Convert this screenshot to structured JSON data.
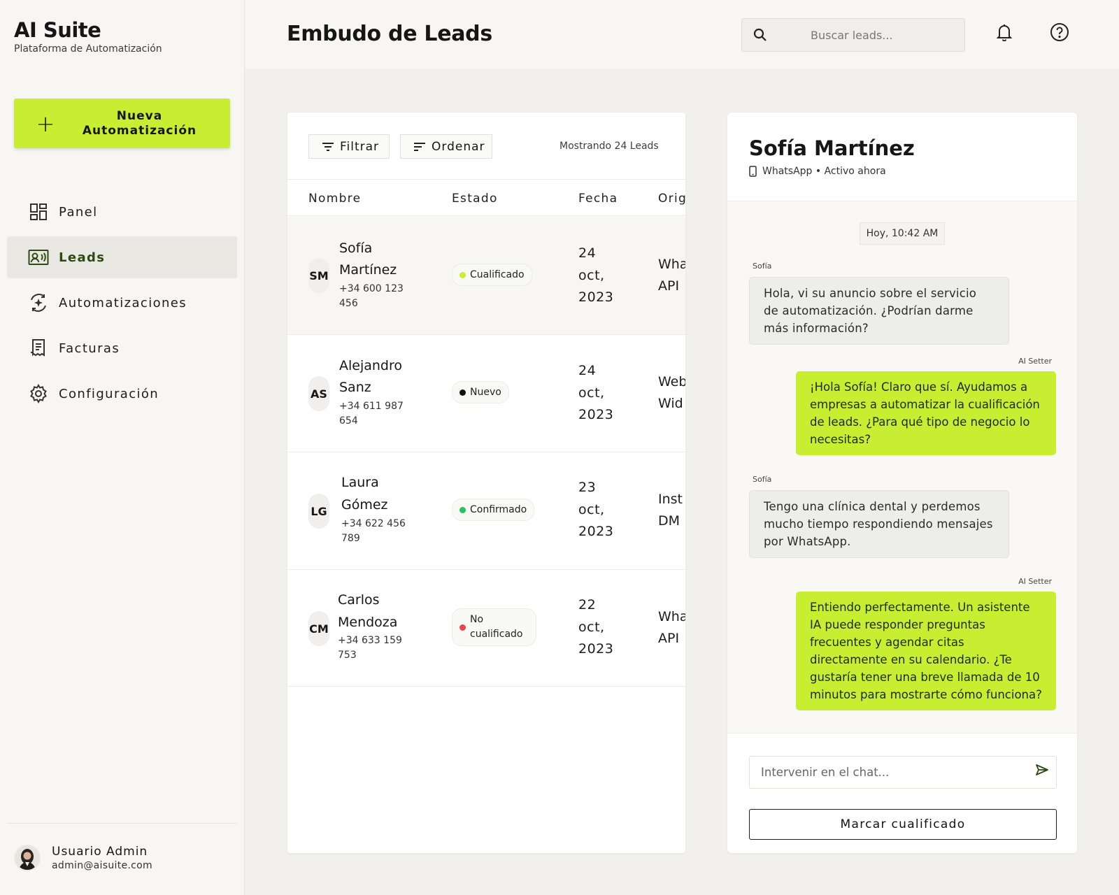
{
  "brand": {
    "title": "AI Suite",
    "subtitle": "Plataforma de Automatización"
  },
  "new_button": {
    "label": "Nueva Automatización"
  },
  "nav": [
    {
      "label": "Panel",
      "icon": "dashboard-icon"
    },
    {
      "label": "Leads",
      "icon": "contact-card-icon",
      "active": true
    },
    {
      "label": "Automatizaciones",
      "icon": "automation-icon"
    },
    {
      "label": "Facturas",
      "icon": "invoice-icon"
    },
    {
      "label": "Configuración",
      "icon": "gear-icon"
    }
  ],
  "user": {
    "name": "Usuario Admin",
    "email": "admin@aisuite.com"
  },
  "header": {
    "title": "Embudo de Leads",
    "search_placeholder": "Buscar leads..."
  },
  "toolbar": {
    "filter_label": "Filtrar",
    "sort_label": "Ordenar",
    "count_text": "Mostrando 24 Leads"
  },
  "columns": [
    "Nombre",
    "Estado",
    "Fecha",
    "Orig"
  ],
  "leads": [
    {
      "initials": "SM",
      "name_lines": [
        "Sofía",
        "Martínez"
      ],
      "phone_lines": [
        "+34 600 123",
        "456"
      ],
      "status": "Cualificado",
      "status_color": "#c8ee32",
      "date_lines": [
        "24",
        "oct,",
        "2023"
      ],
      "source_lines": [
        "Wha",
        "API"
      ]
    },
    {
      "initials": "AS",
      "name_lines": [
        "Alejandro",
        "Sanz"
      ],
      "phone_lines": [
        "+34 611 987",
        "654"
      ],
      "status": "Nuevo",
      "status_color": "#111111",
      "date_lines": [
        "24",
        "oct,",
        "2023"
      ],
      "source_lines": [
        "Web",
        "Wid"
      ]
    },
    {
      "initials": "LG",
      "name_lines": [
        "Laura",
        "Gómez"
      ],
      "phone_lines": [
        "+34 622 456",
        "789"
      ],
      "status": "Confirmado",
      "status_color": "#22c55e",
      "date_lines": [
        "23",
        "oct,",
        "2023"
      ],
      "source_lines": [
        "Inst",
        "DM"
      ]
    },
    {
      "initials": "CM",
      "name_lines": [
        "Carlos",
        "Mendoza"
      ],
      "phone_lines": [
        "+34 633 159",
        "753"
      ],
      "status_lines": [
        "No",
        "cualificado"
      ],
      "status_color": "#ef4444",
      "date_lines": [
        "22",
        "oct,",
        "2023"
      ],
      "source_lines": [
        "Wha",
        "API"
      ]
    }
  ],
  "chat": {
    "name": "Sofía Martínez",
    "channel": "WhatsApp",
    "presence": "Activo ahora",
    "meta_text": "WhatsApp • Activo ahora",
    "timestamp": "Hoy, 10:42 AM",
    "messages": [
      {
        "sender": "Sofía",
        "direction": "in",
        "text": "Hola, vi su anuncio sobre el servicio de automatización. ¿Podrían darme más información?"
      },
      {
        "sender": "AI Setter",
        "direction": "out",
        "text": "¡Hola Sofía! Claro que sí. Ayudamos a empresas a automatizar la cualificación de leads. ¿Para qué tipo de negocio lo necesitas?"
      },
      {
        "sender": "Sofía",
        "direction": "in",
        "text": "Tengo una clínica dental y perdemos mucho tiempo respondiendo mensajes por WhatsApp."
      },
      {
        "sender": "AI Setter",
        "direction": "out",
        "text": "Entiendo perfectamente. Un asistente IA puede responder preguntas frecuentes y agendar citas directamente en su calendario. ¿Te gustaría tener una breve llamada de 10 minutos para mostrarte cómo funciona?"
      }
    ],
    "input_placeholder": "Intervenir en el chat...",
    "mark_button": "Marcar cualificado"
  },
  "colors": {
    "accent": "#c8ee32",
    "active_nav_text": "#2d4a13"
  }
}
